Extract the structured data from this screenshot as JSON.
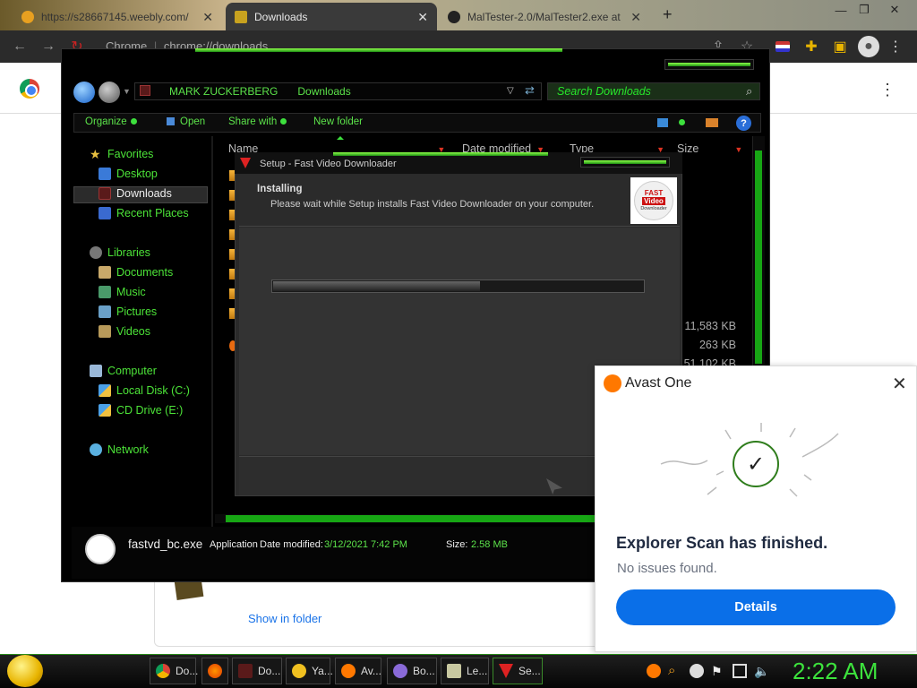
{
  "browser": {
    "tabs": [
      {
        "title": "https://s28667145.weebly.com/",
        "active": false
      },
      {
        "title": "Downloads",
        "active": true
      },
      {
        "title": "MalTester-2.0/MalTester2.exe at",
        "active": false
      }
    ],
    "new_tab": "+",
    "window_controls": {
      "minimize": "—",
      "restore": "❐",
      "close": "✕"
    },
    "omnibox": {
      "site_label": "Chrome",
      "url": "chrome://downloads"
    },
    "toolbar_icons": [
      "back-icon",
      "forward-icon",
      "reload-icon",
      "share-icon",
      "star-icon",
      "flag-icon",
      "extensions-icon",
      "sidebar-icon",
      "profile-icon",
      "menu-icon"
    ]
  },
  "downloads_page": {
    "show_in_folder": "Show in folder",
    "menu": "⋮"
  },
  "explorer": {
    "breadcrumb": [
      "MARK ZUCKERBERG",
      "Downloads"
    ],
    "search_placeholder": "Search Downloads",
    "commands": {
      "organize": "Organize",
      "open": "Open",
      "share_with": "Share with",
      "new_folder": "New folder",
      "help": "?"
    },
    "nav": {
      "favorites": "Favorites",
      "desktop": "Desktop",
      "downloads": "Downloads",
      "recent": "Recent Places",
      "libraries": "Libraries",
      "documents": "Documents",
      "music": "Music",
      "pictures": "Pictures",
      "videos": "Videos",
      "computer": "Computer",
      "local_disk": "Local Disk (C:)",
      "cd_drive": "CD Drive (E:)",
      "network": "Network"
    },
    "columns": [
      "Name",
      "Date modified",
      "Type",
      "Size"
    ],
    "sizes": [
      "11,583 KB",
      "263 KB",
      "51,102 KB"
    ],
    "details": {
      "filename": "fastvd_bc.exe",
      "type": "Application",
      "date_label": "Date modified:",
      "date": "3/12/2021 7:42 PM",
      "size_label": "Size:",
      "size": "2.58 MB"
    }
  },
  "setup": {
    "title": "Setup - Fast Video Downloader",
    "heading": "Installing",
    "message": "Please wait while Setup installs Fast Video Downloader on your computer.",
    "progress": 0.56,
    "logo": {
      "line1": "FAST",
      "line2": "Video",
      "line3": "Downloader"
    }
  },
  "avast": {
    "brand": "Avast One",
    "title": "Explorer Scan has finished.",
    "subtitle": "No issues found.",
    "button": "Details",
    "close": "✕",
    "check": "✓"
  },
  "taskbar": {
    "tasks": [
      {
        "label": "Do...",
        "icon": "chrome-icon"
      },
      {
        "label": "",
        "icon": "firefox-icon"
      },
      {
        "label": "Do...",
        "icon": "folder-icon"
      },
      {
        "label": "Ya...",
        "icon": "yahoo-icon"
      },
      {
        "label": "Av...",
        "icon": "avast-icon"
      },
      {
        "label": "Bo...",
        "icon": "bot-icon"
      },
      {
        "label": "Le...",
        "icon": "notepad-icon"
      },
      {
        "label": "Se...",
        "icon": "setup-icon"
      }
    ],
    "clock": "2:22 AM"
  },
  "colors": {
    "accent_green": "#3de33d",
    "avast_blue": "#0a6fe8",
    "avast_orange": "#ff7800"
  }
}
